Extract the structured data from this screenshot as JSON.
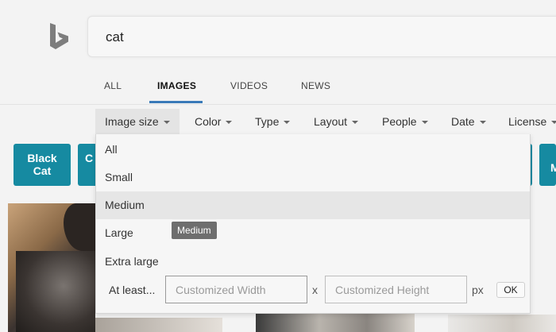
{
  "search": {
    "query": "cat"
  },
  "tabs": [
    {
      "label": "ALL"
    },
    {
      "label": "IMAGES"
    },
    {
      "label": "VIDEOS"
    },
    {
      "label": "NEWS"
    }
  ],
  "filters": [
    {
      "label": "Image size"
    },
    {
      "label": "Color"
    },
    {
      "label": "Type"
    },
    {
      "label": "Layout"
    },
    {
      "label": "People"
    },
    {
      "label": "Date"
    },
    {
      "label": "License"
    }
  ],
  "related": [
    {
      "line1": "Black",
      "line2": "Cat"
    },
    {
      "line1": "C",
      "line2": ""
    },
    {
      "line1": "",
      "line2": ""
    },
    {
      "line1": "M",
      "line2": ""
    }
  ],
  "size_menu": {
    "options": [
      "All",
      "Small",
      "Medium",
      "Large",
      "Extra large"
    ],
    "hovered": "Medium",
    "tooltip": "Medium",
    "at_least_label": "At least...",
    "width_placeholder": "Customized Width",
    "height_placeholder": "Customized Height",
    "separator": "x",
    "unit": "px",
    "ok_label": "OK"
  },
  "colors": {
    "accent": "#3a7ab8",
    "tile": "#168aa1"
  }
}
